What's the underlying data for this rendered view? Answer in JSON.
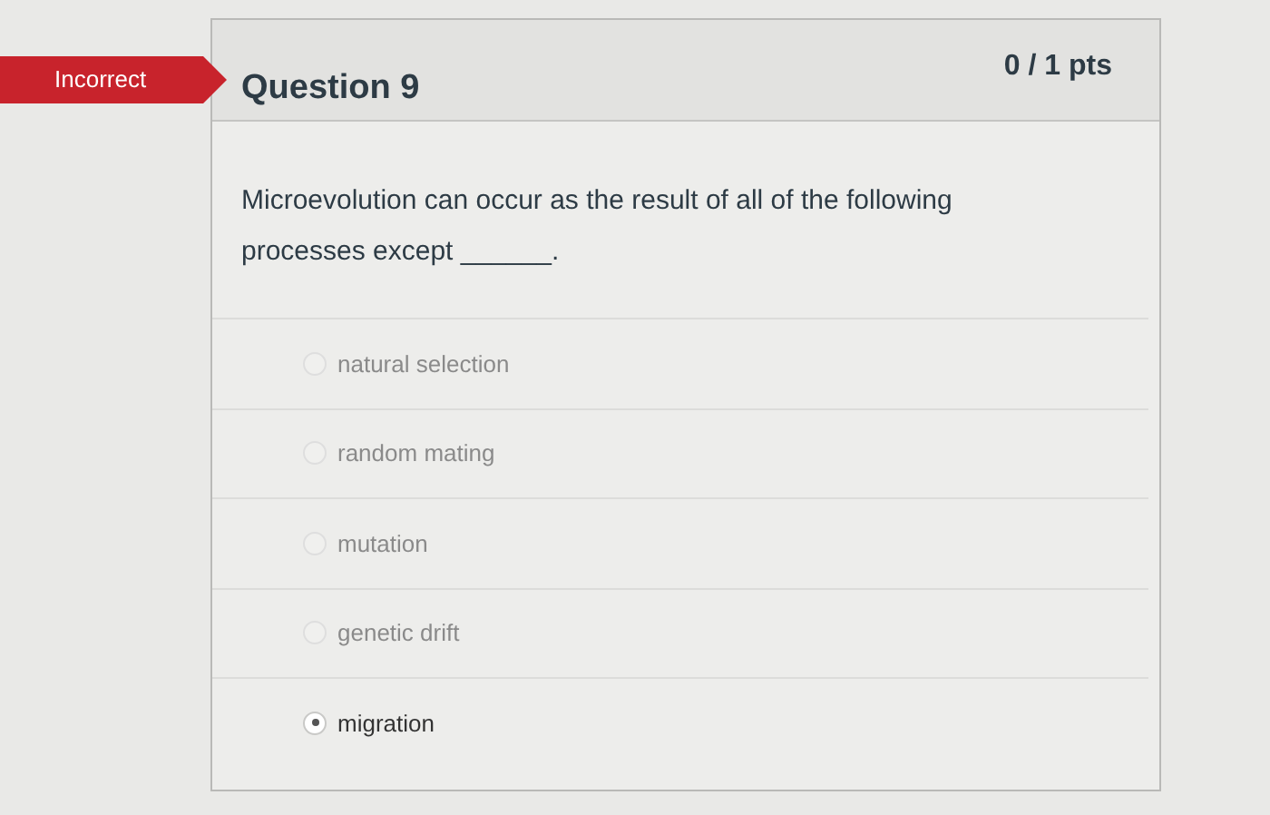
{
  "result_badge": "Incorrect",
  "question": {
    "title": "Question 9",
    "points": "0 / 1 pts",
    "text": "Microevolution can occur as the result of all of the following processes except ______.",
    "answers": [
      {
        "label": "natural selection",
        "selected": false
      },
      {
        "label": "random mating",
        "selected": false
      },
      {
        "label": "mutation",
        "selected": false
      },
      {
        "label": "genetic drift",
        "selected": false
      },
      {
        "label": "migration",
        "selected": true
      }
    ]
  }
}
